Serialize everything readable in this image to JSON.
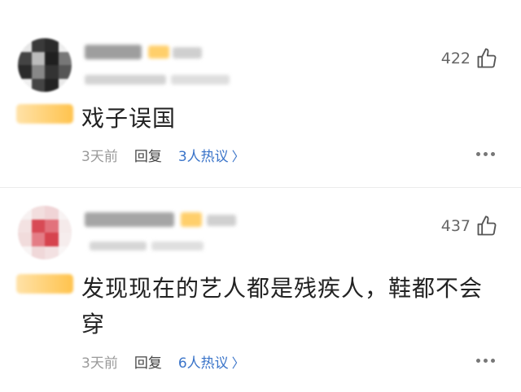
{
  "comments": [
    {
      "likes": "422",
      "text": "戏子误国",
      "time": "3天前",
      "reply_label": "回复",
      "hot_replies": "3人热议",
      "avatar_colors": [
        "#2b2b2b",
        "#bdbdbd",
        "#555",
        "#e8e8e8"
      ]
    },
    {
      "likes": "437",
      "text": "发现现在的艺人都是残疾人，鞋都不会穿",
      "time": "3天前",
      "reply_label": "回复",
      "hot_replies": "6人热议",
      "avatar_colors": [
        "#f2d4d4",
        "#d9454f",
        "#f7f0f0",
        "#e07b84"
      ]
    }
  ],
  "colors": {
    "link": "#3a74c9",
    "badge": "#ffc34d"
  },
  "icons": {
    "like": "thumbs-up-icon",
    "more": "more-dots-icon",
    "chevron": "chevron-right-icon"
  }
}
